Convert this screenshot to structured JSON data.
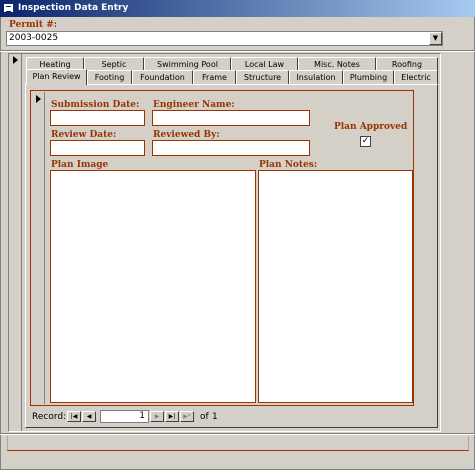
{
  "window": {
    "title": "Inspection Data Entry"
  },
  "header": {
    "permit_label": "Permit #:",
    "permit_value": "2003-0025"
  },
  "tabs": {
    "row_back": [
      "Heating",
      "Septic",
      "Swimming Pool",
      "Local Law",
      "Misc. Notes",
      "Roofing"
    ],
    "row_front": [
      "Plan Review",
      "Footing",
      "Foundation",
      "Frame",
      "Structure",
      "Insulation",
      "Plumbing",
      "Electric"
    ],
    "active": "Plan Review"
  },
  "plan_review": {
    "submission_date_label": "Submission Date:",
    "submission_date_value": "",
    "engineer_name_label": "Engineer Name:",
    "engineer_name_value": "",
    "review_date_label": "Review Date:",
    "review_date_value": "",
    "reviewed_by_label": "Reviewed By:",
    "reviewed_by_value": "",
    "plan_approved_label": "Plan Approved",
    "plan_approved_checked": true,
    "plan_image_label": "Plan Image",
    "plan_notes_label": "Plan Notes:"
  },
  "record_nav": {
    "label": "Record:",
    "current": "1",
    "of_label": "of",
    "total": "1"
  },
  "icons": {
    "record_selector": "record-selector-triangle",
    "dropdown": "chevron-down",
    "first": "first-record",
    "prev": "previous-record",
    "next": "next-record",
    "last": "last-record",
    "new": "new-record",
    "check": "checkmark"
  }
}
